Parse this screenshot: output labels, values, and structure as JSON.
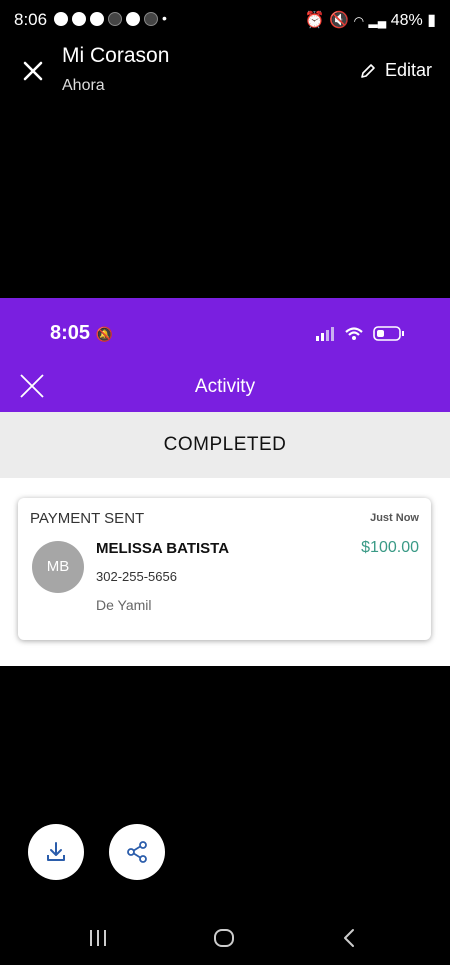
{
  "status_bar": {
    "time": "8:06",
    "battery": "48%"
  },
  "viewer": {
    "title": "Mi Corason",
    "subtitle": "Ahora",
    "edit_label": "Editar"
  },
  "shot": {
    "status_time": "8:05",
    "title": "Activity",
    "band_label": "COMPLETED",
    "card": {
      "type": "PAYMENT SENT",
      "time": "Just Now",
      "avatar_initials": "MB",
      "name": "MELISSA BATISTA",
      "phone": "302-255-5656",
      "note": "De Yamil",
      "amount": "$100.00"
    }
  },
  "colors": {
    "header_purple": "#7a1fe0",
    "amount_green": "#3a9a86"
  },
  "icons": [
    "close-icon",
    "pencil-icon",
    "download-icon",
    "share-icon",
    "recents-icon",
    "home-icon",
    "back-icon"
  ]
}
